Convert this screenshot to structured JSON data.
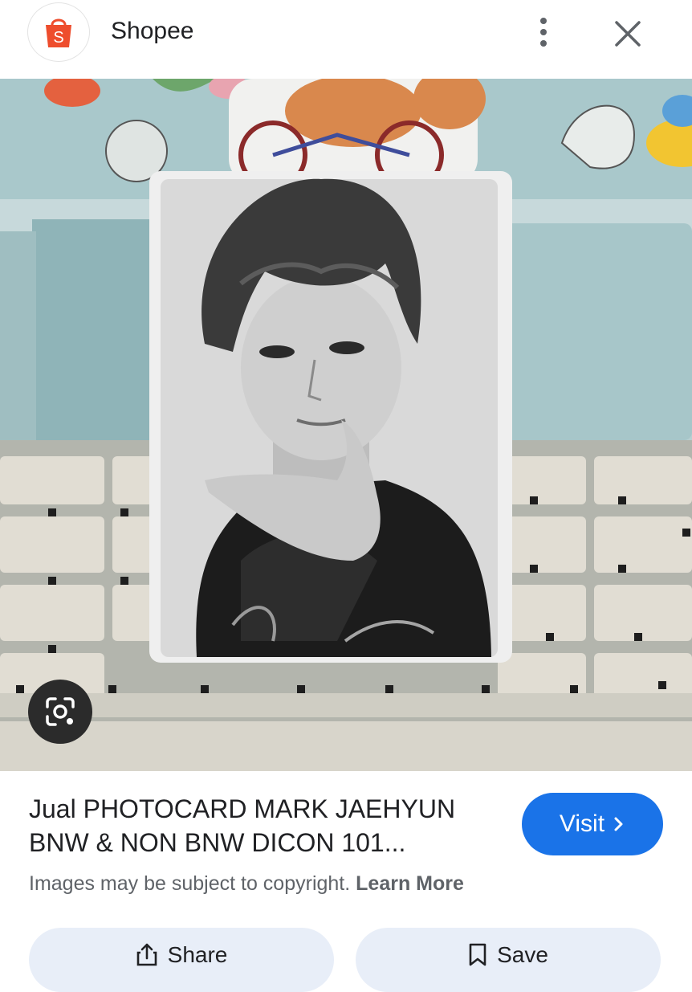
{
  "header": {
    "site_name": "Shopee",
    "logo_icon": "shopee-bag-icon",
    "logo_letter": "S",
    "menu_icon": "more-vert-icon",
    "close_icon": "close-icon"
  },
  "image": {
    "lens_icon": "google-lens-icon"
  },
  "result": {
    "title_line1": "Jual PHOTOCARD MARK JAEHYUN",
    "title_line2": "BNW & NON BNW DICON 101...",
    "visit_label": "Visit",
    "copyright_text": "Images may be subject to copyright.",
    "learn_more": "Learn More"
  },
  "actions": {
    "share_label": "Share",
    "save_label": "Save"
  },
  "colors": {
    "accent": "#1a73e8",
    "shopee": "#ee4d2d",
    "action_bg": "#e8eef8"
  }
}
